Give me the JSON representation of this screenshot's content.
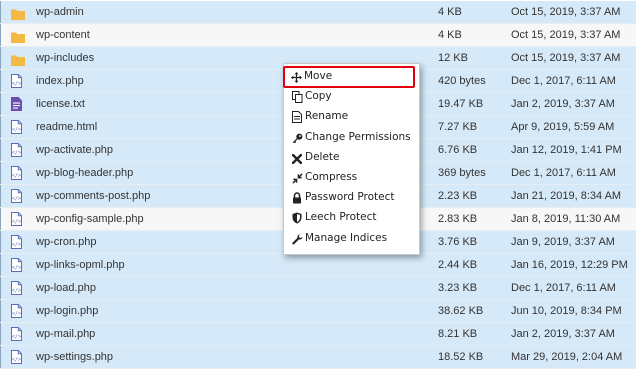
{
  "files": [
    {
      "name": "wp-admin",
      "size": "4 KB",
      "date": "Oct 15, 2019, 3:37 AM",
      "type": "folder",
      "icon": "folder-icon",
      "selected": true
    },
    {
      "name": "wp-content",
      "size": "4 KB",
      "date": "Oct 15, 2019, 3:37 AM",
      "type": "folder",
      "icon": "folder-icon",
      "selected": false
    },
    {
      "name": "wp-includes",
      "size": "12 KB",
      "date": "Oct 15, 2019, 3:37 AM",
      "type": "folder",
      "icon": "folder-icon",
      "selected": true
    },
    {
      "name": "index.php",
      "size": "420 bytes",
      "date": "Dec 1, 2017, 6:11 AM",
      "type": "code",
      "icon": "php-file-icon",
      "selected": true
    },
    {
      "name": "license.txt",
      "size": "19.47 KB",
      "date": "Jan 2, 2019, 3:37 AM",
      "type": "text",
      "icon": "text-file-icon",
      "selected": true
    },
    {
      "name": "readme.html",
      "size": "7.27 KB",
      "date": "Apr 9, 2019, 5:59 AM",
      "type": "code",
      "icon": "html-file-icon",
      "selected": true
    },
    {
      "name": "wp-activate.php",
      "size": "6.76 KB",
      "date": "Jan 12, 2019, 1:41 PM",
      "type": "code",
      "icon": "php-file-icon",
      "selected": true
    },
    {
      "name": "wp-blog-header.php",
      "size": "369 bytes",
      "date": "Dec 1, 2017, 6:11 AM",
      "type": "code",
      "icon": "php-file-icon",
      "selected": true
    },
    {
      "name": "wp-comments-post.php",
      "size": "2.23 KB",
      "date": "Jan 21, 2019, 8:34 AM",
      "type": "code",
      "icon": "php-file-icon",
      "selected": true
    },
    {
      "name": "wp-config-sample.php",
      "size": "2.83 KB",
      "date": "Jan 8, 2019, 11:30 AM",
      "type": "code",
      "icon": "php-file-icon",
      "selected": false
    },
    {
      "name": "wp-cron.php",
      "size": "3.76 KB",
      "date": "Jan 9, 2019, 3:37 AM",
      "type": "code",
      "icon": "php-file-icon",
      "selected": true
    },
    {
      "name": "wp-links-opml.php",
      "size": "2.44 KB",
      "date": "Jan 16, 2019, 12:29 PM",
      "type": "code",
      "icon": "php-file-icon",
      "selected": true
    },
    {
      "name": "wp-load.php",
      "size": "3.23 KB",
      "date": "Dec 1, 2017, 6:11 AM",
      "type": "code",
      "icon": "php-file-icon",
      "selected": true
    },
    {
      "name": "wp-login.php",
      "size": "38.62 KB",
      "date": "Jun 10, 2019, 8:34 PM",
      "type": "code",
      "icon": "php-file-icon",
      "selected": true
    },
    {
      "name": "wp-mail.php",
      "size": "8.21 KB",
      "date": "Jan 2, 2019, 3:37 AM",
      "type": "code",
      "icon": "php-file-icon",
      "selected": true
    },
    {
      "name": "wp-settings.php",
      "size": "18.52 KB",
      "date": "Mar 29, 2019, 2:04 AM",
      "type": "code",
      "icon": "php-file-icon",
      "selected": true
    }
  ],
  "context_menu": {
    "items": [
      {
        "label": "Move",
        "icon": "move-arrows-icon",
        "highlighted": true
      },
      {
        "label": "Copy",
        "icon": "copy-icon",
        "highlighted": false
      },
      {
        "label": "Rename",
        "icon": "rename-document-icon",
        "highlighted": false
      },
      {
        "label": "Change Permissions",
        "icon": "key-icon",
        "highlighted": false
      },
      {
        "label": "Delete",
        "icon": "x-delete-icon",
        "highlighted": false
      },
      {
        "label": "Compress",
        "icon": "compress-icon",
        "highlighted": false
      },
      {
        "label": "Password Protect",
        "icon": "lock-icon",
        "highlighted": false
      },
      {
        "label": "Leech Protect",
        "icon": "shield-icon",
        "highlighted": false
      },
      {
        "label": "Manage Indices",
        "icon": "wrench-icon",
        "highlighted": false
      }
    ]
  },
  "colors": {
    "selected_row": "#d6e9f8",
    "unselected_row": "#f7f7f7",
    "folder": "#f4b942",
    "code_file": "#5b6fb8",
    "text_file": "#6a4fb0",
    "highlight_frame": "#e0000f"
  }
}
